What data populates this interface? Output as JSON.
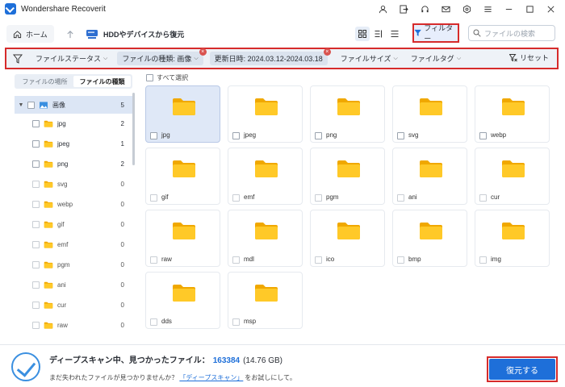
{
  "app": {
    "title": "Wondershare Recoverit"
  },
  "window_icons": [
    "user-icon",
    "sign-out-icon",
    "headset-icon",
    "mail-icon",
    "settings-hex-icon",
    "menu-icon",
    "minimize-icon",
    "maximize-icon",
    "close-icon"
  ],
  "toolbar": {
    "home_label": "ホーム",
    "drive_label": "HDDやデバイスから復元",
    "filter_label": "フィルター",
    "search_placeholder": "ファイルの検索"
  },
  "filterbar": {
    "file_status": "ファイルステータス",
    "file_type": "ファイルの種類: 画像",
    "date_modified": "更新日時: 2024.03.12-2024.03.18",
    "file_size": "ファイルサイズ",
    "file_tag": "ファイルタグ",
    "reset": "リセット"
  },
  "sidebar": {
    "tabs": [
      "ファイルの場所",
      "ファイルの種類"
    ],
    "root": {
      "label": "画像",
      "count": "5"
    },
    "items": [
      {
        "label": "jpg",
        "count": "2"
      },
      {
        "label": "jpeg",
        "count": "1"
      },
      {
        "label": "png",
        "count": "2"
      },
      {
        "label": "svg",
        "count": "0"
      },
      {
        "label": "webp",
        "count": "0"
      },
      {
        "label": "gif",
        "count": "0"
      },
      {
        "label": "emf",
        "count": "0"
      },
      {
        "label": "pgm",
        "count": "0"
      },
      {
        "label": "ani",
        "count": "0"
      },
      {
        "label": "cur",
        "count": "0"
      },
      {
        "label": "raw",
        "count": "0"
      }
    ]
  },
  "main": {
    "select_all": "すべて選択",
    "folders": [
      "jpg",
      "jpeg",
      "png",
      "svg",
      "webp",
      "gif",
      "emf",
      "pgm",
      "ani",
      "cur",
      "raw",
      "mdl",
      "ico",
      "bmp",
      "img",
      "dds",
      "msp"
    ]
  },
  "status": {
    "scan_text": "ディープスキャン中、見つかったファイル：",
    "count": "163384",
    "size": "(14.76 GB)",
    "hint_prefix": "まだ失われたファイルが見つかりませんか？",
    "hint_link": "「ディープスキャン」",
    "hint_suffix": "をお試しにして。",
    "recover_label": "復元する"
  },
  "colors": {
    "accent": "#1e6fd9",
    "highlight": "#d62b2b",
    "folder": "#f7b500"
  }
}
